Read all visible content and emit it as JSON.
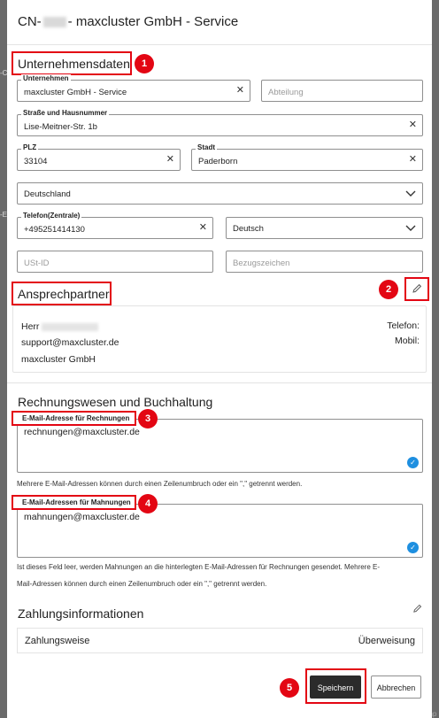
{
  "modal": {
    "title_prefix": "CN-",
    "title_suffix": "- maxcluster GmbH - Service"
  },
  "company_section": {
    "heading": "Unternehmensdaten",
    "badge": "1",
    "company_label": "Unternehmen",
    "company_value": "maxcluster GmbH - Service",
    "department_placeholder": "Abteilung",
    "street_label": "Straße und Hausnummer",
    "street_value": "Lise-Meitner-Str. 1b",
    "zip_label": "PLZ",
    "zip_value": "33104",
    "city_label": "Stadt",
    "city_value": "Paderborn",
    "country_value": "Deutschland",
    "phone_label": "Telefon(Zentrale)",
    "phone_value": "+495251414130",
    "language_value": "Deutsch",
    "vat_placeholder": "USt-ID",
    "reference_placeholder": "Bezugszeichen"
  },
  "contact_section": {
    "heading": "Ansprechpartner",
    "edit_badge": "2",
    "salutation": "Herr",
    "email": "support@maxcluster.de",
    "company": "maxcluster GmbH",
    "phone_label": "Telefon:",
    "mobile_label": "Mobil:"
  },
  "billing_section": {
    "heading": "Rechnungswesen und Buchhaltung",
    "invoice_email_label": "E-Mail-Adresse für Rechnungen",
    "invoice_email_badge": "3",
    "invoice_email_value": "rechnungen@maxcluster.de",
    "invoice_hint": "Mehrere E-Mail-Adressen können durch einen Zeilenumbruch oder ein \",\" getrennt werden.",
    "dunning_email_label": "E-Mail-Adressen für Mahnungen",
    "dunning_email_badge": "4",
    "dunning_email_value": "mahnungen@maxcluster.de",
    "dunning_hint_line1": "Ist dieses Feld leer, werden Mahnungen an die hinterlegten E-Mail-Adressen für Rechnungen gesendet. Mehrere E-",
    "dunning_hint_line2": "Mail-Adressen können durch einen Zeilenumbruch oder ein \",\" getrennt werden."
  },
  "payment_section": {
    "heading": "Zahlungsinformationen",
    "method_label": "Zahlungsweise",
    "method_value": "Überweisung"
  },
  "footer": {
    "save_label": "Speichern",
    "save_badge": "5",
    "cancel_label": "Abbrechen"
  },
  "background": {
    "edge_text_1": "-E",
    "edge_text_2": "-C",
    "edge_text_3": "Imp"
  },
  "colors": {
    "highlight": "#e30613",
    "primary_button": "#2b2b2b",
    "check_icon": "#1e8fe0"
  }
}
